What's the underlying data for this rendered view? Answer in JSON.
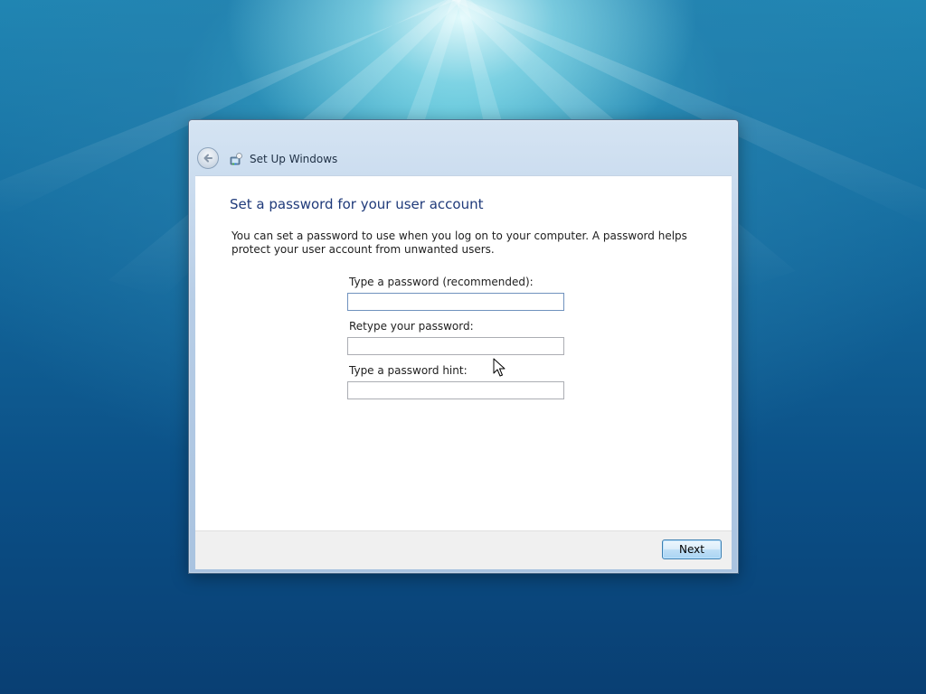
{
  "window": {
    "title": "Set Up Windows",
    "icons": {
      "back": "back-arrow-icon",
      "app": "setup-windows-icon"
    }
  },
  "page": {
    "heading": "Set a password for your user account",
    "description": "You can set a password to use when you log on to your computer. A password helps protect your user account from unwanted users."
  },
  "form": {
    "password": {
      "label": "Type a password (recommended):",
      "value": "",
      "placeholder": ""
    },
    "retype": {
      "label": "Retype your password:",
      "value": "",
      "placeholder": ""
    },
    "hint": {
      "label": "Type a password hint:",
      "value": "",
      "placeholder": ""
    }
  },
  "footer": {
    "next_label": "Next"
  },
  "colors": {
    "heading": "#1f3a7a",
    "button_border": "#3c7fb1",
    "desktop_dark": "#093f73",
    "desktop_light": "#d6fbff"
  }
}
